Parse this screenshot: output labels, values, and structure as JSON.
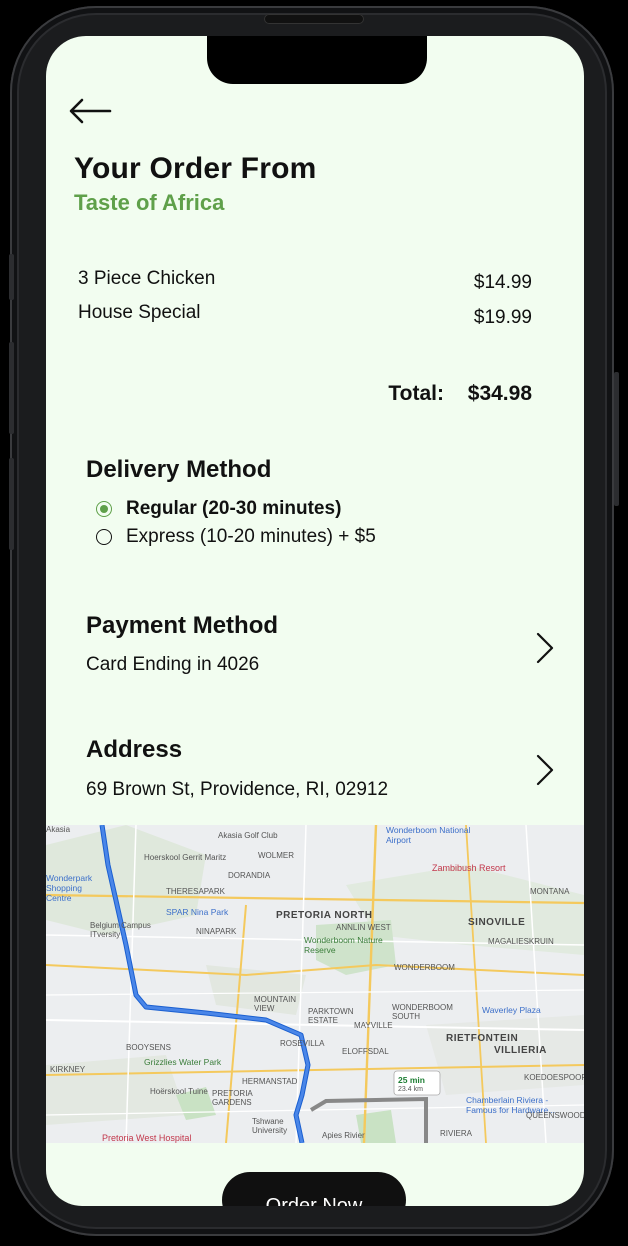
{
  "header": {
    "title": "Your Order From",
    "restaurant": "Taste of Africa"
  },
  "order": {
    "items": [
      {
        "name": "3 Piece Chicken",
        "price": "$14.99"
      },
      {
        "name": "House Special",
        "price": "$19.99"
      }
    ],
    "total_label": "Total:",
    "total_value": "$34.98"
  },
  "delivery": {
    "title": "Delivery Method",
    "options": [
      {
        "label": "Regular (20-30 minutes)",
        "selected": true
      },
      {
        "label": "Express (10-20 minutes) + $5",
        "selected": false
      }
    ]
  },
  "payment": {
    "title": "Payment Method",
    "value": "Card Ending in 4026"
  },
  "address": {
    "title": "Address",
    "value": "69 Brown St, Providence, RI, 02912"
  },
  "map": {
    "labels": {
      "akasia": "Akasia",
      "akasia_golf": "Akasia Golf Club",
      "wonderboom_airport": "Wonderboom National Airport",
      "hoerskool": "Hoerskool Gerrit Maritz",
      "wolmer": "WOLMER",
      "dorandia": "DORANDIA",
      "zambibush": "Zambibush Resort",
      "wonderpark": "Wonderpark Shopping Centre",
      "theresapark": "THERESAPARK",
      "montana": "MONTANA",
      "spar": "SPAR Nina Park",
      "pretoria_north": "PRETORIA NORTH",
      "sinoville": "SINOVILLE",
      "belgium": "Belgium Campus ITversity",
      "ninapark": "NINAPARK",
      "annlin": "ANNLIN WEST",
      "wonderboom_nature": "Wonderboom Nature Reserve",
      "wonderboom": "WONDERBOOM",
      "magaliesruin": "MAGALIESKRUIN",
      "mountain_view": "MOUNTAIN VIEW",
      "parktown": "PARKTOWN ESTATE",
      "wonderboom_south": "WONDERBOOM SOUTH",
      "waverley": "Waverley Plaza",
      "rietfontein": "RIETFONTEIN",
      "villieria": "VILLIERIA",
      "boovsens": "BOOYSENS",
      "rosevilla": "ROSEVILLA",
      "mayville": "MAYVILLE",
      "eloffsdal": "ELOFFSDAL",
      "grizzlies": "Grizzlies Water Park",
      "kirkney": "KIRKNEY",
      "hermanstad": "HERMANSTAD",
      "hoerskool_tuine": "Hoërskool Tuine",
      "pretoria_gardens": "PRETORIA GARDENS",
      "tshwane": "Tshwane University",
      "chamberlain": "Chamberlain Riviera - Famous for Hardware...",
      "riviera": "RIVIERA",
      "queenswood": "QUEENSWOOD",
      "pretoria_west": "Pretoria West Hospital",
      "apies": "Apies Rivier",
      "koedoespoort": "KOEDOESPOORT"
    },
    "eta_time": "25 min",
    "eta_distance": "23.4 km"
  },
  "cta": {
    "order_label": "Order Now"
  },
  "colors": {
    "accent": "#5fa04a",
    "background": "#f2fdf0",
    "button": "#101010",
    "route": "#4a86e8"
  }
}
